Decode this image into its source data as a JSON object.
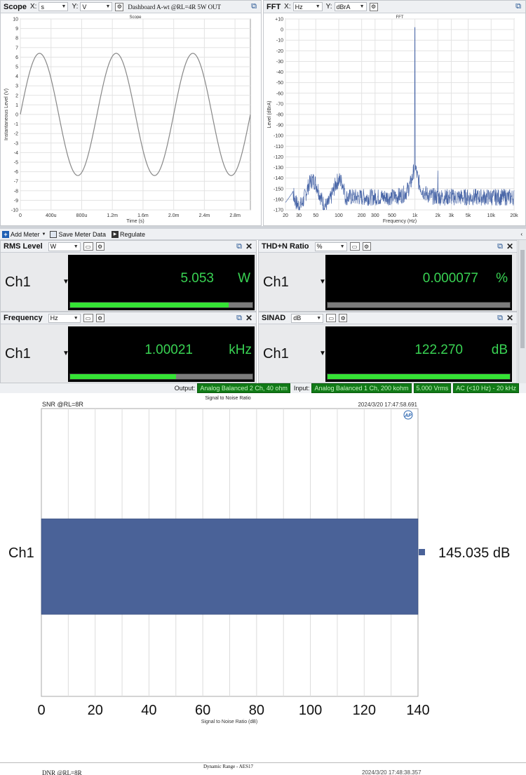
{
  "scope": {
    "title": "Scope",
    "x_label": "X:",
    "x_unit": "s",
    "y_label": "Y:",
    "y_unit": "V",
    "preset": "Dashboard A-wt @RL=4R 5W OUT",
    "chart_title": "Scope",
    "chart_data": {
      "type": "line",
      "title": "Scope",
      "xlabel": "Time (s)",
      "ylabel": "Instantaneous Level (V)",
      "xlim": [
        0,
        0.003
      ],
      "ylim": [
        -10,
        10
      ],
      "x_ticks": [
        "0",
        "400u",
        "800u",
        "1.2m",
        "1.6m",
        "2.0m",
        "2.4m",
        "2.8m"
      ],
      "y_ticks": [
        "10",
        "9",
        "8",
        "7",
        "6",
        "5",
        "4",
        "3",
        "2",
        "1",
        "0",
        "-1",
        "-2",
        "-3",
        "-4",
        "-5",
        "-6",
        "-7",
        "-8",
        "-9",
        "-10"
      ],
      "series": [
        {
          "name": "",
          "frequency_hz": 1000,
          "amplitude_v": 6.4,
          "phase": "sine"
        }
      ]
    }
  },
  "fft": {
    "title": "FFT",
    "x_label": "X:",
    "x_unit": "Hz",
    "y_label": "Y:",
    "y_unit": "dBrA",
    "chart_title": "FFT",
    "chart_data": {
      "type": "line",
      "title": "FFT",
      "xlabel": "Frequency (Hz)",
      "ylabel": "Level (dBrA)",
      "xscale": "log",
      "xlim": [
        20,
        20000
      ],
      "ylim": [
        -170,
        10
      ],
      "x_ticks": [
        "20",
        "30",
        "50",
        "100",
        "200",
        "300",
        "500",
        "1k",
        "2k",
        "3k",
        "5k",
        "10k",
        "20k"
      ],
      "y_ticks": [
        "+10",
        "0",
        "-10",
        "-20",
        "-30",
        "-40",
        "-50",
        "-60",
        "-70",
        "-80",
        "-90",
        "-100",
        "-110",
        "-120",
        "-130",
        "-140",
        "-150",
        "-160",
        "-170"
      ],
      "peaks": [
        {
          "x": 1000,
          "y": 2
        },
        {
          "x": 2000,
          "y": -133
        },
        {
          "x": 3000,
          "y": -150
        }
      ],
      "noise_floor_db": -158
    }
  },
  "toolbar": {
    "add_meter": "Add Meter",
    "save_meter_data": "Save Meter Data",
    "regulate": "Regulate"
  },
  "meters": [
    {
      "title": "RMS Level",
      "unit_select": "W",
      "channel": "Ch1",
      "value": "5.053",
      "unit": "W",
      "fill": 0.87
    },
    {
      "title": "THD+N Ratio",
      "unit_select": "%",
      "channel": "Ch1",
      "value": "0.000077",
      "unit": "%",
      "fill": 0.0
    },
    {
      "title": "Frequency",
      "unit_select": "Hz",
      "channel": "Ch1",
      "value": "1.00021",
      "unit": "kHz",
      "fill": 0.58
    },
    {
      "title": "SINAD",
      "unit_select": "dB",
      "channel": "Ch1",
      "value": "122.270",
      "unit": "dB",
      "fill": 1.0
    }
  ],
  "status": {
    "output_label": "Output:",
    "output_value": "Analog Balanced 2 Ch, 40 ohm",
    "input_label": "Input:",
    "input_value": "Analog Balanced 1 Ch, 200 kohm",
    "level": "5.000 Vrms",
    "filter": "AC (<10 Hz) - 20 kHz"
  },
  "snr": {
    "chart_title": "Signal to Noise Ratio",
    "subtitle": "SNR @RL=8R",
    "timestamp": "2024/3/20 17:47:58.691",
    "logo": "AP",
    "chart_data": {
      "type": "bar",
      "orientation": "horizontal",
      "title": "Signal to Noise Ratio",
      "xlabel": "Signal to Noise Ratio (dB)",
      "xlim": [
        0,
        140
      ],
      "x_ticks": [
        "0",
        "20",
        "40",
        "60",
        "80",
        "100",
        "120",
        "140"
      ],
      "categories": [
        "Ch1"
      ],
      "values": [
        145.035
      ],
      "value_label": "145.035 dB",
      "color": "#4a6298"
    }
  },
  "dnr": {
    "chart_title": "Dynamic Range - AES17",
    "subtitle": "DNR @RL=8R",
    "timestamp": "2024/3/20 17:48:38.357"
  },
  "colors": {
    "accent_green": "#39d353",
    "bar_blue": "#4a6298",
    "status_green": "#117a17"
  }
}
